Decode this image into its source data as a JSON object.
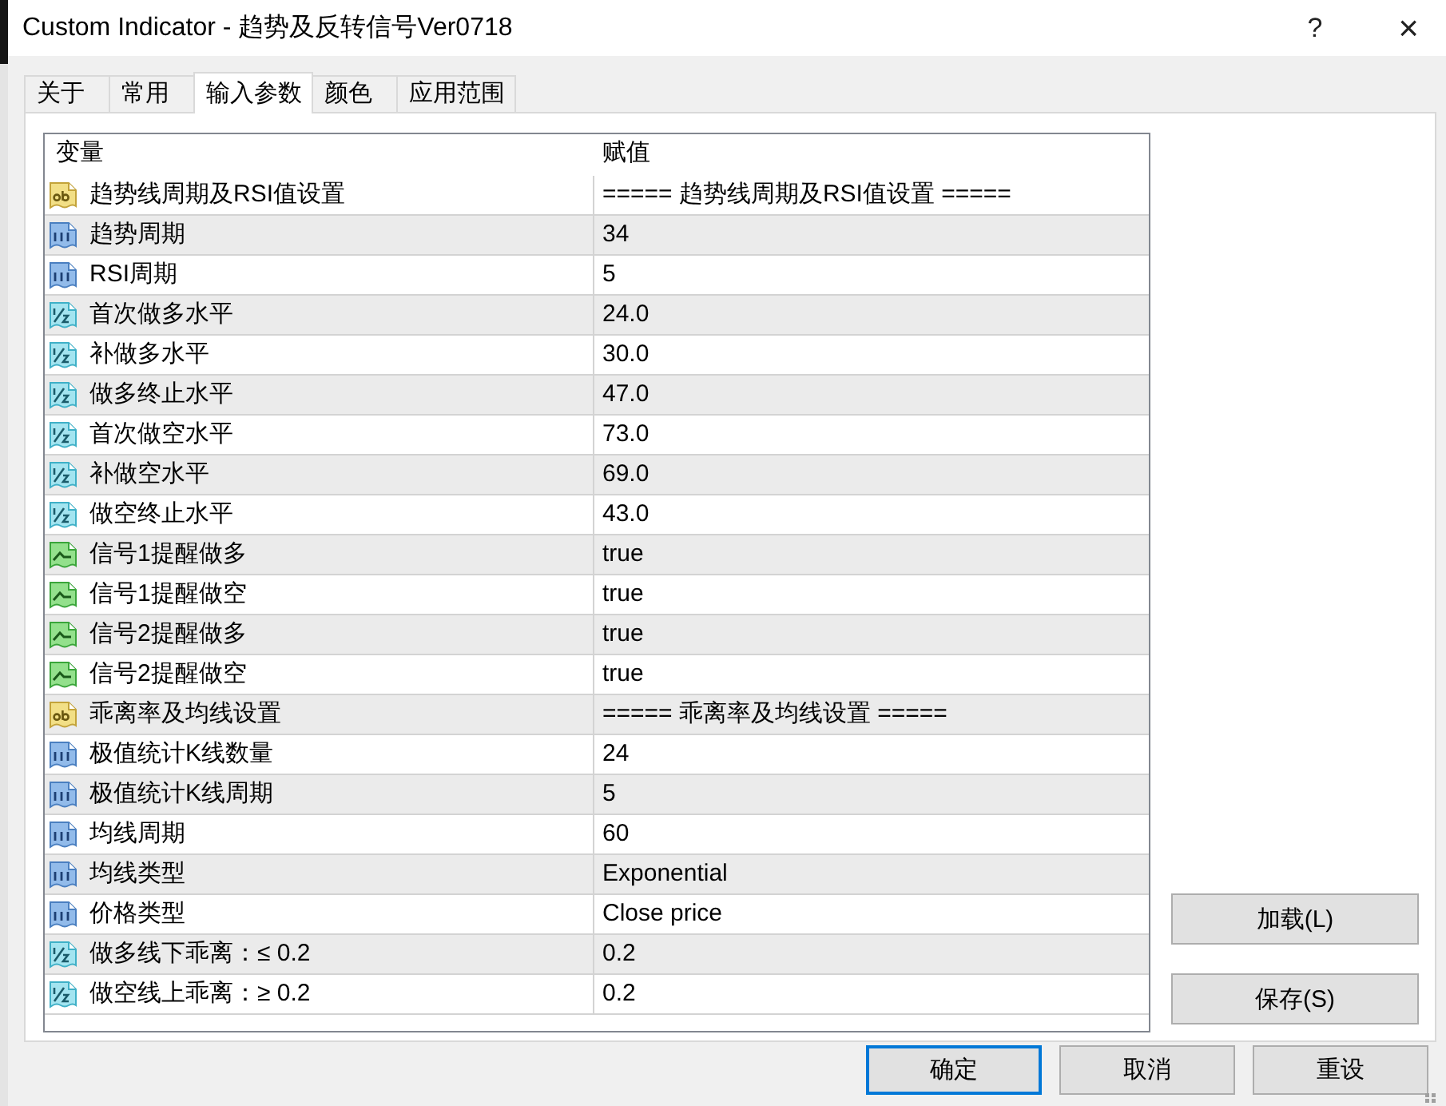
{
  "window": {
    "title": "Custom Indicator - 趋势及反转信号Ver0718",
    "help": "?",
    "close": "×"
  },
  "tabs": [
    {
      "label": "关于",
      "selected": false
    },
    {
      "label": "常用",
      "selected": false
    },
    {
      "label": "输入参数",
      "selected": true
    },
    {
      "label": "颜色",
      "selected": false
    },
    {
      "label": "应用范围",
      "selected": false
    }
  ],
  "table": {
    "columns": [
      "变量",
      "赋值"
    ],
    "rows": [
      {
        "kind": "string",
        "name": "趋势线周期及RSI值设置",
        "value": "===== 趋势线周期及RSI值设置 ====="
      },
      {
        "kind": "int",
        "name": "趋势周期",
        "value": "34"
      },
      {
        "kind": "int",
        "name": "RSI周期",
        "value": "5"
      },
      {
        "kind": "double",
        "name": "首次做多水平",
        "value": "24.0"
      },
      {
        "kind": "double",
        "name": "补做多水平",
        "value": "30.0"
      },
      {
        "kind": "double",
        "name": "做多终止水平",
        "value": "47.0"
      },
      {
        "kind": "double",
        "name": "首次做空水平",
        "value": "73.0"
      },
      {
        "kind": "double",
        "name": "补做空水平",
        "value": "69.0"
      },
      {
        "kind": "double",
        "name": "做空终止水平",
        "value": "43.0"
      },
      {
        "kind": "bool",
        "name": "信号1提醒做多",
        "value": "true"
      },
      {
        "kind": "bool",
        "name": "信号1提醒做空",
        "value": "true"
      },
      {
        "kind": "bool",
        "name": "信号2提醒做多",
        "value": "true"
      },
      {
        "kind": "bool",
        "name": "信号2提醒做空",
        "value": "true"
      },
      {
        "kind": "string",
        "name": "乖离率及均线设置",
        "value": "===== 乖离率及均线设置 ====="
      },
      {
        "kind": "int",
        "name": "极值统计K线数量",
        "value": "24"
      },
      {
        "kind": "int",
        "name": "极值统计K线周期",
        "value": "5"
      },
      {
        "kind": "int",
        "name": "均线周期",
        "value": "60"
      },
      {
        "kind": "int",
        "name": "均线类型",
        "value": "Exponential"
      },
      {
        "kind": "int",
        "name": "价格类型",
        "value": "Close price"
      },
      {
        "kind": "double",
        "name": "做多线下乖离：≤ 0.2",
        "value": "0.2"
      },
      {
        "kind": "double",
        "name": "做空线上乖离：≥ 0.2",
        "value": "0.2"
      }
    ]
  },
  "side_buttons": [
    "加载(L)",
    "保存(S)"
  ],
  "buttons": [
    {
      "label": "确定",
      "default": true
    },
    {
      "label": "取消",
      "default": false
    },
    {
      "label": "重设",
      "default": false
    }
  ]
}
